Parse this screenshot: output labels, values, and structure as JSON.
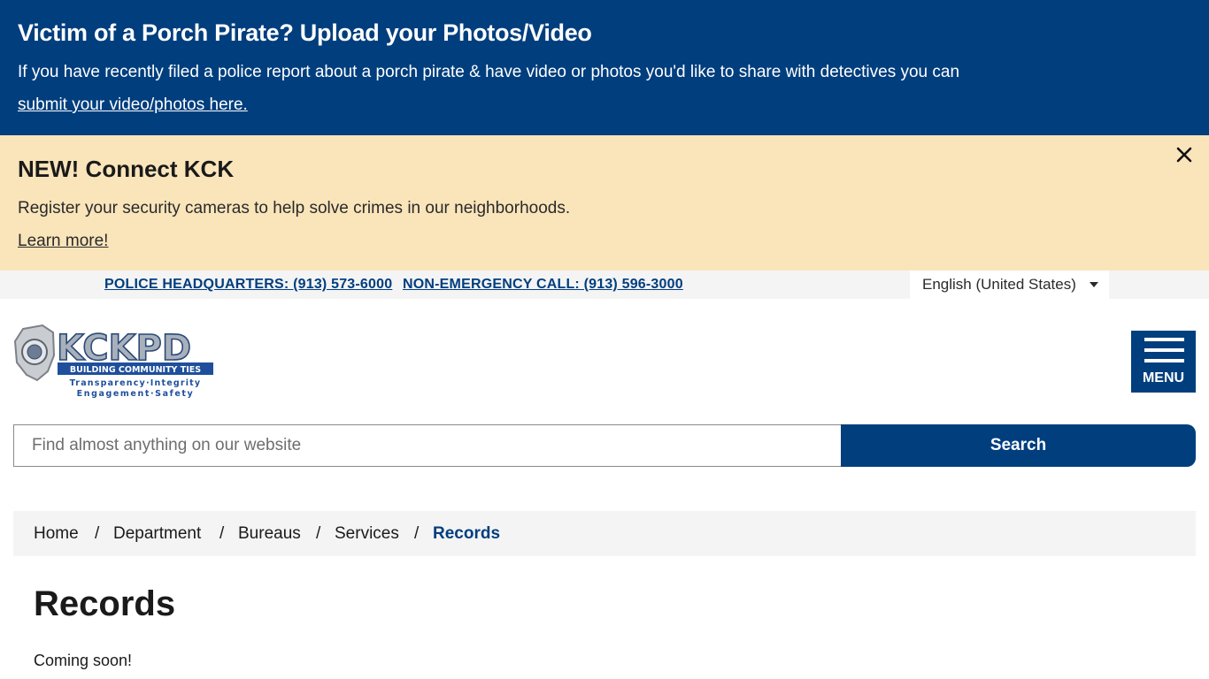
{
  "porch_alert": {
    "title": "Victim of a Porch Pirate? Upload your Photos/Video",
    "body": "If you have recently filed a police report about a porch pirate & have video or photos you'd like to share with detectives you can",
    "link": "submit your video/photos here."
  },
  "connect_alert": {
    "title": "NEW! Connect KCK",
    "body": "Register your security cameras to help solve crimes in our neighborhoods.",
    "link": "Learn more!",
    "close_icon": "close-icon"
  },
  "utility": {
    "headquarters": "POLICE HEADQUARTERS: (913) 573-6000",
    "non_emergency": "NON-EMERGENCY CALL: (913) 596-3000",
    "language": "English (United States)"
  },
  "header": {
    "logo": {
      "wordmark": "KCKPD",
      "tagline": "BUILDING COMMUNITY TIES",
      "values_1": "Transparency·Integrity",
      "values_2": "Engagement·Safety"
    },
    "menu_label": "MENU"
  },
  "search": {
    "placeholder": "Find almost anything on our website",
    "button": "Search"
  },
  "breadcrumb": {
    "items": [
      "Home",
      "Department",
      "Bureaus",
      "Services"
    ],
    "separator": "/",
    "current": "Records"
  },
  "page": {
    "title": "Records",
    "body": "Coming soon!"
  },
  "colors": {
    "brand_blue": "#003e7e",
    "alert_yellow": "#fae5bb",
    "light_gray": "#f4f4f4"
  }
}
